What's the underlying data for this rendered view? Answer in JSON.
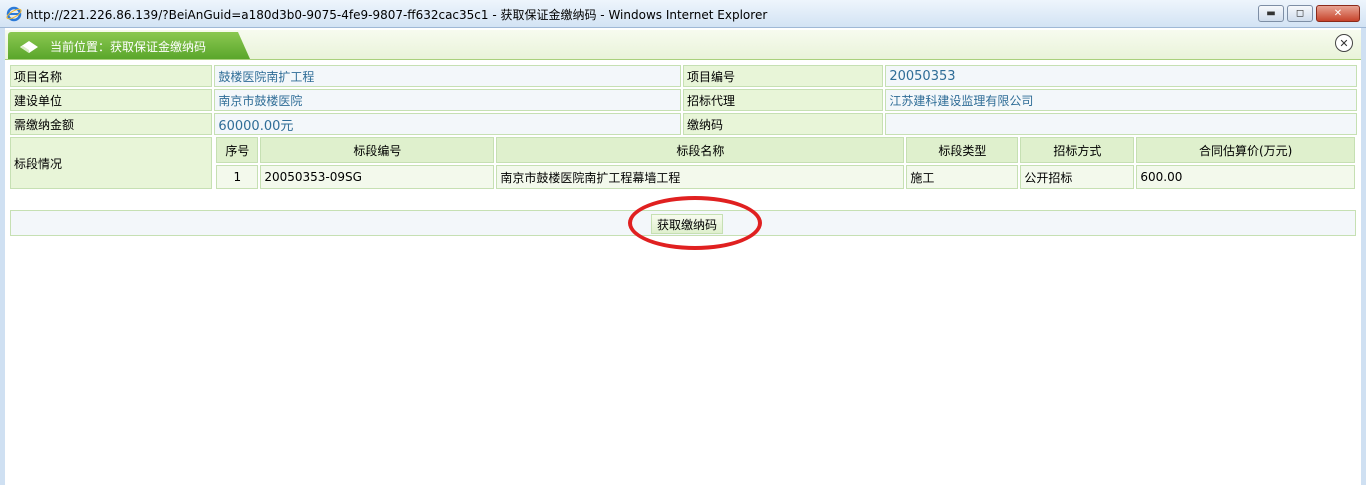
{
  "window": {
    "title": "http://221.226.86.139/?BeiAnGuid=a180d3b0-9075-4fe9-9807-ff632cac35c1 - 获取保证金缴纳码 - Windows Internet Explorer",
    "min_label": "▬",
    "max_label": "◻",
    "close_label": "✕"
  },
  "location": {
    "text": "当前位置：获取保证金缴纳码",
    "close_label": "✕"
  },
  "info": {
    "project_name_label": "项目名称",
    "project_name_value": "鼓楼医院南扩工程",
    "project_no_label": "项目编号",
    "project_no_value": "20050353",
    "builder_label": "建设单位",
    "builder_value": "南京市鼓楼医院",
    "agent_label": "招标代理",
    "agent_value": "江苏建科建设监理有限公司",
    "amount_label": "需缴纳金额",
    "amount_value": "60000.00元",
    "code_label": "缴纳码",
    "code_value": "",
    "section_label": "标段情况"
  },
  "sections": {
    "headers": [
      "序号",
      "标段编号",
      "标段名称",
      "标段类型",
      "招标方式",
      "合同估算价(万元)"
    ],
    "rows": [
      [
        "1",
        "20050353-09SG",
        "南京市鼓楼医院南扩工程幕墙工程",
        "施工",
        "公开招标",
        "600.00"
      ]
    ]
  },
  "actions": {
    "get_code_label": "获取缴纳码"
  },
  "colors": {
    "accent_green": "#5aa62b",
    "highlight_red": "#e02020",
    "value_blue": "#2f6d97"
  }
}
